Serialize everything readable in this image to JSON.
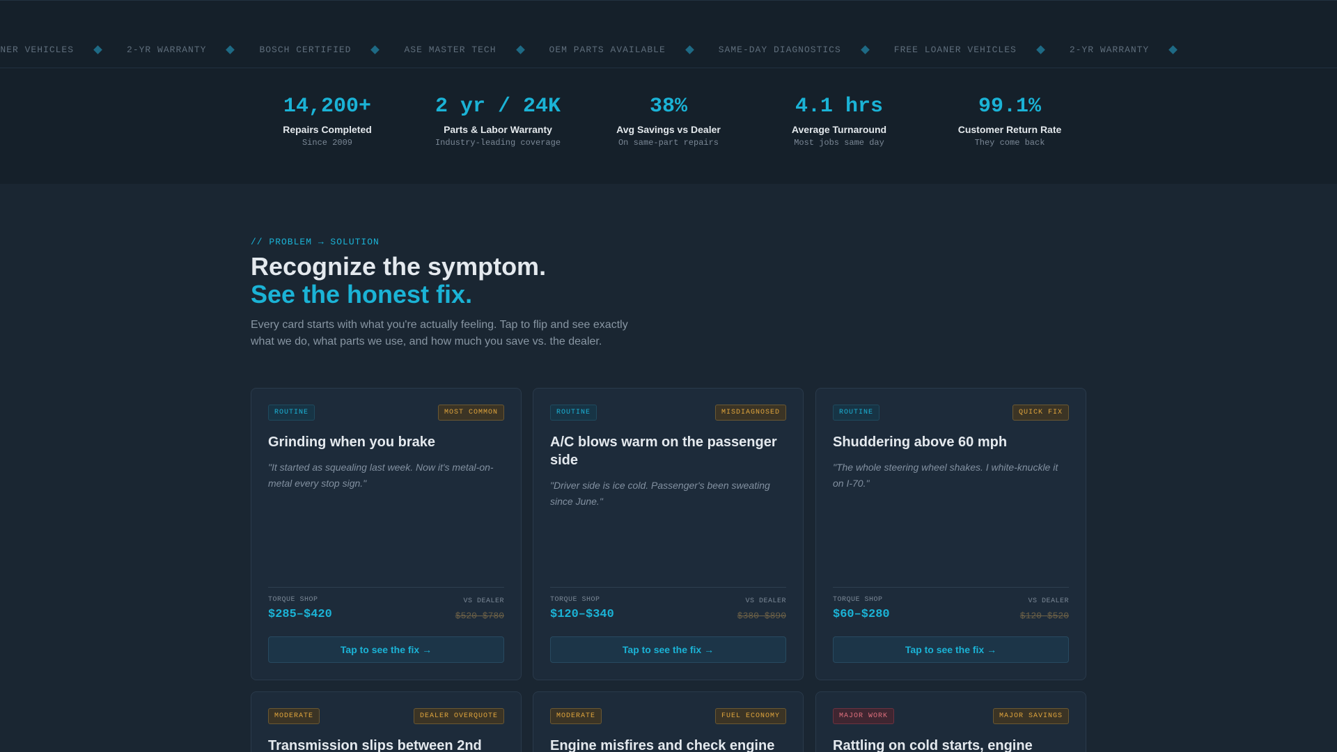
{
  "ticker": {
    "items": [
      "FREE LOANER VEHICLES",
      "2-YR WARRANTY",
      "BOSCH CERTIFIED",
      "ASE MASTER TECH",
      "OEM PARTS AVAILABLE",
      "SAME-DAY DIAGNOSTICS",
      "FREE LOANER VEHICLES",
      "2-YR WARRANTY"
    ]
  },
  "stats": [
    {
      "value": "14,200+",
      "label": "Repairs Completed",
      "sub": "Since 2009"
    },
    {
      "value": "2 yr / 24K",
      "label": "Parts & Labor Warranty",
      "sub": "Industry-leading coverage"
    },
    {
      "value": "38%",
      "label": "Avg Savings vs Dealer",
      "sub": "On same-part repairs"
    },
    {
      "value": "4.1 hrs",
      "label": "Average Turnaround",
      "sub": "Most jobs same day"
    },
    {
      "value": "99.1%",
      "label": "Customer Return Rate",
      "sub": "They come back"
    }
  ],
  "section": {
    "eyebrow": "// PROBLEM → SOLUTION",
    "headline": "Recognize the symptom.",
    "headline_accent": "See the honest fix.",
    "intro": "Every card starts with what you're actually feeling. Tap to flip and see exactly what we do, what parts we use, and how much you save vs. the dealer."
  },
  "labels": {
    "shop": "TORQUE SHOP",
    "dealer": "VS DEALER",
    "cta": "Tap to see the fix →"
  },
  "cards": [
    {
      "level": "ROUTINE",
      "tag": "MOST COMMON",
      "title": "Grinding when you brake",
      "quote": "\"It started as squealing last week. Now it's metal-on-metal every stop sign.\"",
      "price": "$285–$420",
      "dealer_price": "$520–$780"
    },
    {
      "level": "ROUTINE",
      "tag": "MISDIAGNOSED",
      "title": "A/C blows warm on the passenger side",
      "quote": "\"Driver side is ice cold. Passenger's been sweating since June.\"",
      "price": "$120–$340",
      "dealer_price": "$380–$890"
    },
    {
      "level": "ROUTINE",
      "tag": "QUICK FIX",
      "title": "Shuddering above 60 mph",
      "quote": "\"The whole steering wheel shakes. I white-knuckle it on I-70.\"",
      "price": "$60–$280",
      "dealer_price": "$120–$520"
    },
    {
      "level": "MODERATE",
      "tag": "DEALER OVERQUOTE",
      "title": "Transmission slips between 2nd"
    },
    {
      "level": "MODERATE",
      "tag": "FUEL ECONOMY",
      "title": "Engine misfires and check engine"
    },
    {
      "level": "MAJOR WORK",
      "tag": "MAJOR SAVINGS",
      "title": "Rattling on cold starts, engine"
    }
  ],
  "colors": {
    "accent": "#1bb3d6",
    "warning": "#e0a53d",
    "danger": "#e0707d",
    "background": "#1a2632"
  }
}
